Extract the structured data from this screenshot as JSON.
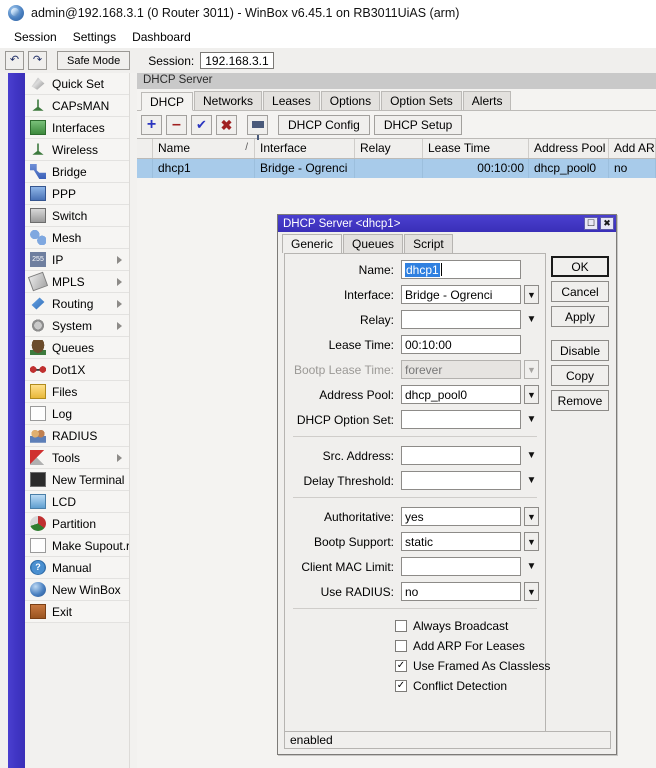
{
  "window": {
    "title": "admin@192.168.3.1 (0 Router 3011) - WinBox v6.45.1 on RB3011UiAS (arm)",
    "icon": "winbox-logo-icon"
  },
  "menubar": {
    "items": [
      {
        "label": "Session"
      },
      {
        "label": "Settings"
      },
      {
        "label": "Dashboard"
      }
    ]
  },
  "toolbar": {
    "undo_icon": "undo-arrow-icon",
    "redo_icon": "redo-arrow-icon",
    "safe_mode_label": "Safe Mode",
    "session_label": "Session:",
    "session_value": "192.168.3.1"
  },
  "sidebar": {
    "items": [
      {
        "label": "Quick Set",
        "icon": "quick-set-icon",
        "submenu": false
      },
      {
        "label": "CAPsMAN",
        "icon": "capsman-icon",
        "submenu": false
      },
      {
        "label": "Interfaces",
        "icon": "interfaces-icon",
        "submenu": false
      },
      {
        "label": "Wireless",
        "icon": "wireless-icon",
        "submenu": false
      },
      {
        "label": "Bridge",
        "icon": "bridge-icon",
        "submenu": false
      },
      {
        "label": "PPP",
        "icon": "ppp-icon",
        "submenu": false
      },
      {
        "label": "Switch",
        "icon": "switch-icon",
        "submenu": false
      },
      {
        "label": "Mesh",
        "icon": "mesh-icon",
        "submenu": false
      },
      {
        "label": "IP",
        "icon": "ip-icon",
        "submenu": true
      },
      {
        "label": "MPLS",
        "icon": "mpls-icon",
        "submenu": true
      },
      {
        "label": "Routing",
        "icon": "routing-icon",
        "submenu": true
      },
      {
        "label": "System",
        "icon": "system-gear-icon",
        "submenu": true
      },
      {
        "label": "Queues",
        "icon": "queues-icon",
        "submenu": false
      },
      {
        "label": "Dot1X",
        "icon": "dot1x-icon",
        "submenu": false
      },
      {
        "label": "Files",
        "icon": "files-folder-icon",
        "submenu": false
      },
      {
        "label": "Log",
        "icon": "log-icon",
        "submenu": false
      },
      {
        "label": "RADIUS",
        "icon": "radius-icon",
        "submenu": false
      },
      {
        "label": "Tools",
        "icon": "tools-icon",
        "submenu": true
      },
      {
        "label": "New Terminal",
        "icon": "terminal-icon",
        "submenu": false
      },
      {
        "label": "LCD",
        "icon": "lcd-monitor-icon",
        "submenu": false
      },
      {
        "label": "Partition",
        "icon": "partition-icon",
        "submenu": false
      },
      {
        "label": "Make Supout.rif",
        "icon": "supout-file-icon",
        "submenu": false
      },
      {
        "label": "Manual",
        "icon": "manual-help-icon",
        "submenu": false
      },
      {
        "label": "New WinBox",
        "icon": "new-winbox-icon",
        "submenu": false
      },
      {
        "label": "Exit",
        "icon": "exit-door-icon",
        "submenu": false
      }
    ]
  },
  "panel": {
    "caption": "DHCP Server",
    "tabs": [
      {
        "label": "DHCP",
        "active": true
      },
      {
        "label": "Networks",
        "active": false
      },
      {
        "label": "Leases",
        "active": false
      },
      {
        "label": "Options",
        "active": false
      },
      {
        "label": "Option Sets",
        "active": false
      },
      {
        "label": "Alerts",
        "active": false
      }
    ],
    "toolbar": {
      "add_icon": "plus-icon",
      "remove_icon": "minus-icon",
      "enable_icon": "check-icon",
      "disable_icon": "x-icon",
      "filter_icon": "funnel-filter-icon",
      "dhcp_config_label": "DHCP Config",
      "dhcp_setup_label": "DHCP Setup"
    },
    "table": {
      "columns": [
        "Name",
        "Interface",
        "Relay",
        "Lease Time",
        "Address Pool",
        "Add AR..."
      ],
      "sort_indicator": "/",
      "rows": [
        {
          "selected": true,
          "name": "dhcp1",
          "interface": "Bridge - Ogrenci",
          "relay": "",
          "lease_time": "00:10:00",
          "address_pool": "dhcp_pool0",
          "add_arp": "no"
        }
      ]
    }
  },
  "dialog": {
    "title": "DHCP Server <dhcp1>",
    "maximize_icon": "maximize-icon",
    "close_icon": "close-icon",
    "tabs": [
      {
        "label": "Generic",
        "active": true
      },
      {
        "label": "Queues",
        "active": false
      },
      {
        "label": "Script",
        "active": false
      }
    ],
    "fields": [
      {
        "label": "Name:",
        "value": "dhcp1",
        "control": "text",
        "selected": true,
        "disabled": false
      },
      {
        "label": "Interface:",
        "value": "Bridge - Ogrenci",
        "control": "spinner",
        "selected": false,
        "disabled": false
      },
      {
        "label": "Relay:",
        "value": "",
        "control": "caret",
        "selected": false,
        "disabled": false
      },
      {
        "label": "Lease Time:",
        "value": "00:10:00",
        "control": "text",
        "selected": false,
        "disabled": false
      },
      {
        "label": "Bootp Lease Time:",
        "value": "forever",
        "control": "spinner",
        "selected": false,
        "disabled": true
      },
      {
        "label": "Address Pool:",
        "value": "dhcp_pool0",
        "control": "spinner",
        "selected": false,
        "disabled": false
      },
      {
        "label": "DHCP Option Set:",
        "value": "",
        "control": "caret",
        "selected": false,
        "disabled": false
      }
    ],
    "fields_group2": [
      {
        "label": "Src. Address:",
        "value": "",
        "control": "caret",
        "disabled": false
      },
      {
        "label": "Delay Threshold:",
        "value": "",
        "control": "caret",
        "disabled": false
      }
    ],
    "fields_group3": [
      {
        "label": "Authoritative:",
        "value": "yes",
        "control": "spinner",
        "disabled": false
      },
      {
        "label": "Bootp Support:",
        "value": "static",
        "control": "spinner",
        "disabled": false
      },
      {
        "label": "Client MAC Limit:",
        "value": "",
        "control": "caret",
        "disabled": false
      },
      {
        "label": "Use RADIUS:",
        "value": "no",
        "control": "spinner",
        "disabled": false
      }
    ],
    "checkboxes": [
      {
        "label": "Always Broadcast",
        "checked": false
      },
      {
        "label": "Add ARP For Leases",
        "checked": false
      },
      {
        "label": "Use Framed As Classless",
        "checked": true
      },
      {
        "label": "Conflict Detection",
        "checked": true
      }
    ],
    "buttons": [
      {
        "label": "OK",
        "default": true,
        "gap": false
      },
      {
        "label": "Cancel",
        "default": false,
        "gap": false
      },
      {
        "label": "Apply",
        "default": false,
        "gap": false
      },
      {
        "label": "Disable",
        "default": false,
        "gap": true
      },
      {
        "label": "Copy",
        "default": false,
        "gap": false
      },
      {
        "label": "Remove",
        "default": false,
        "gap": false
      }
    ],
    "status": "enabled"
  },
  "colors": {
    "accent_blue": "#4a3fcf",
    "selection_blue": "#a8cbea",
    "text_selection": "#2f80e0",
    "caption_gray": "#c9c9c9",
    "window_bg": "#f0efed"
  }
}
